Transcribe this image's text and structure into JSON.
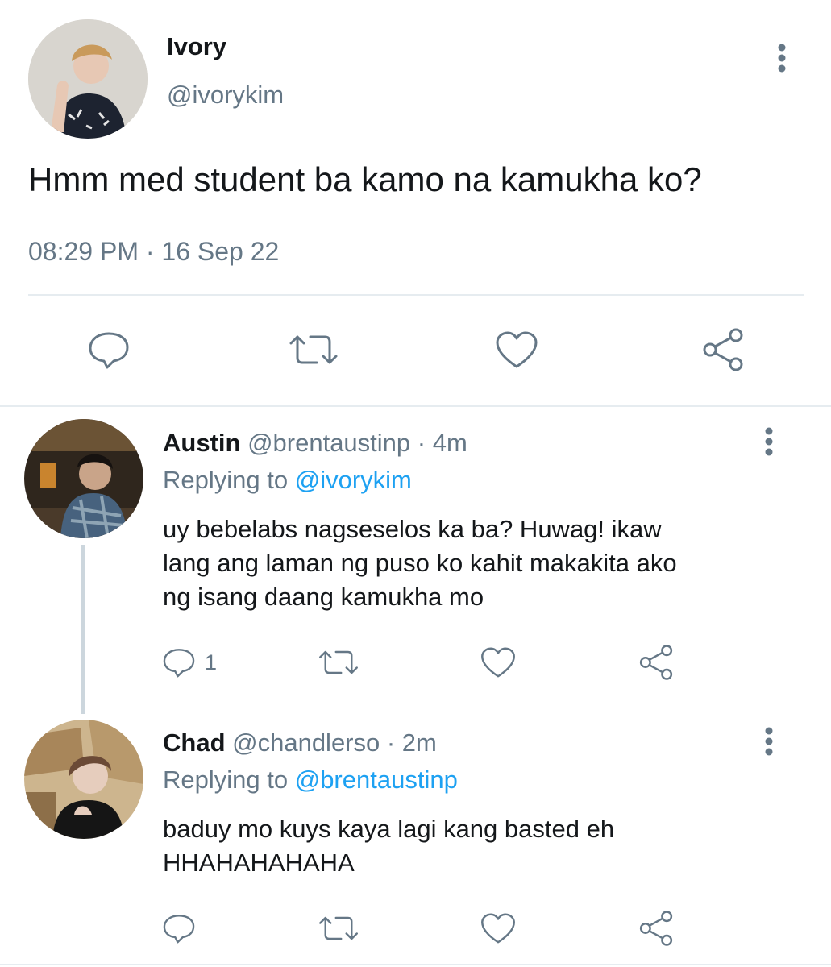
{
  "main_tweet": {
    "author_name": "Ivory",
    "handle": "@ivorykim",
    "text": "Hmm med student ba kamo na kamukha ko?",
    "timestamp": "08:29 PM · 16 Sep 22",
    "avatar_icon": "user-avatar-photo",
    "actions": [
      "reply-icon",
      "retweet-icon",
      "like-icon",
      "share-icon"
    ]
  },
  "replies": [
    {
      "author_name": "Austin",
      "handle": "@brentaustinp",
      "time_ago": "· 4m",
      "replying_label": "Replying to",
      "replying_to": "@ivorykim",
      "text_lines": [
        "uy bebelabs nagseselos ka ba? Huwag! ikaw",
        "lang ang laman ng puso ko kahit makakita ako",
        "ng isang daang kamukha mo"
      ],
      "reply_count": "1"
    },
    {
      "author_name": "Chad",
      "handle": "@chandlerso",
      "time_ago": "· 2m",
      "replying_label": "Replying to",
      "replying_to": "@brentaustinp",
      "text_lines": [
        "baduy mo kuys kaya lagi kang basted eh",
        "HHAHAHAHAHA"
      ],
      "reply_count": ""
    }
  ],
  "colors": {
    "text": "#14171a",
    "muted": "#657786",
    "link": "#1da1f2",
    "divider": "#e6ecf0"
  }
}
